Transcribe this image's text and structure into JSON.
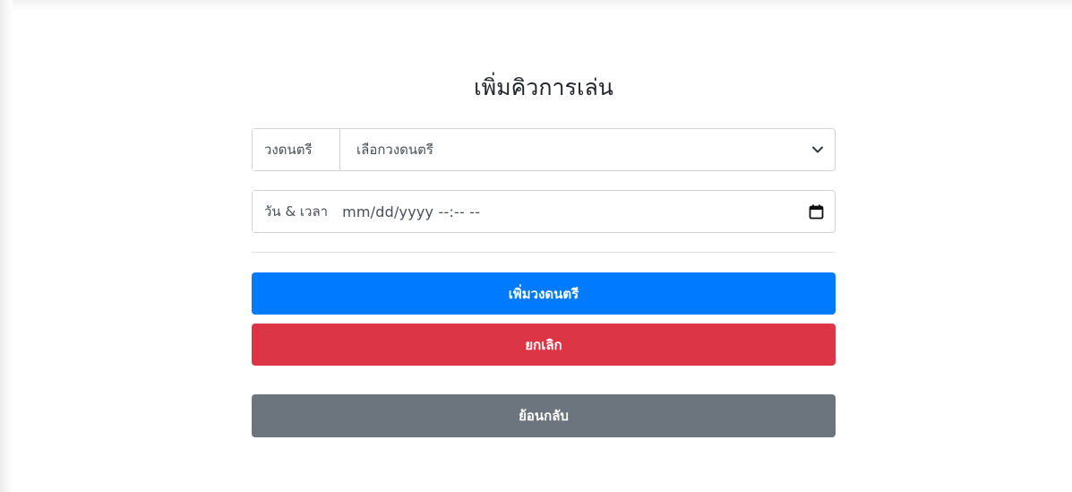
{
  "page": {
    "title": "เพิ่มคิวการเล่น"
  },
  "form": {
    "band": {
      "label": "วงดนตรี",
      "selected": "เลือกวงดนตรี"
    },
    "datetime": {
      "label": "วัน & เวลา",
      "value": "mm/dd/yyyy --:-- --"
    }
  },
  "buttons": {
    "add_label": "เพิ่มวงดนตรี",
    "cancel_label": "ยกเลิก",
    "back_label": "ย้อนกลับ"
  },
  "colors": {
    "primary": "#007bff",
    "danger": "#dc3545",
    "secondary": "#6c757d",
    "border": "#ced4da"
  },
  "icons": {
    "select": "chevron-down-icon",
    "date": "calendar-icon"
  }
}
